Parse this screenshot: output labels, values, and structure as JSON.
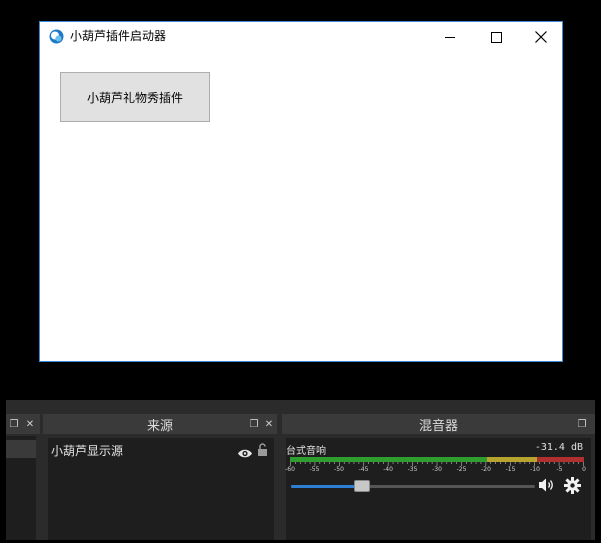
{
  "window": {
    "title": "小葫芦插件启动器",
    "launch_button": "小葫芦礼物秀插件"
  },
  "colors": {
    "window_border": "#3b8ad8",
    "accent": "#2d7fd3",
    "meter_green": "#2f9e2f",
    "meter_yellow": "#b6a42f",
    "meter_red": "#b02f2f"
  },
  "dock": {
    "sources_panel": {
      "title": "来源",
      "items": [
        {
          "label": "小葫芦显示源",
          "visible_icon": "eye-icon",
          "lock_icon": "unlocked-lock-icon"
        }
      ]
    },
    "mixer_panel": {
      "title": "混音器",
      "channel": {
        "name": "台式音响",
        "level": "-31.4 dB",
        "meter_labels": [
          "-60",
          "-55",
          "-50",
          "-45",
          "-40",
          "-35",
          "-30",
          "-25",
          "-20",
          "-15",
          "-10",
          "-5",
          "0"
        ],
        "volume_fraction": 0.29
      }
    },
    "header_icons": [
      "float-icon",
      "close-icon"
    ]
  }
}
